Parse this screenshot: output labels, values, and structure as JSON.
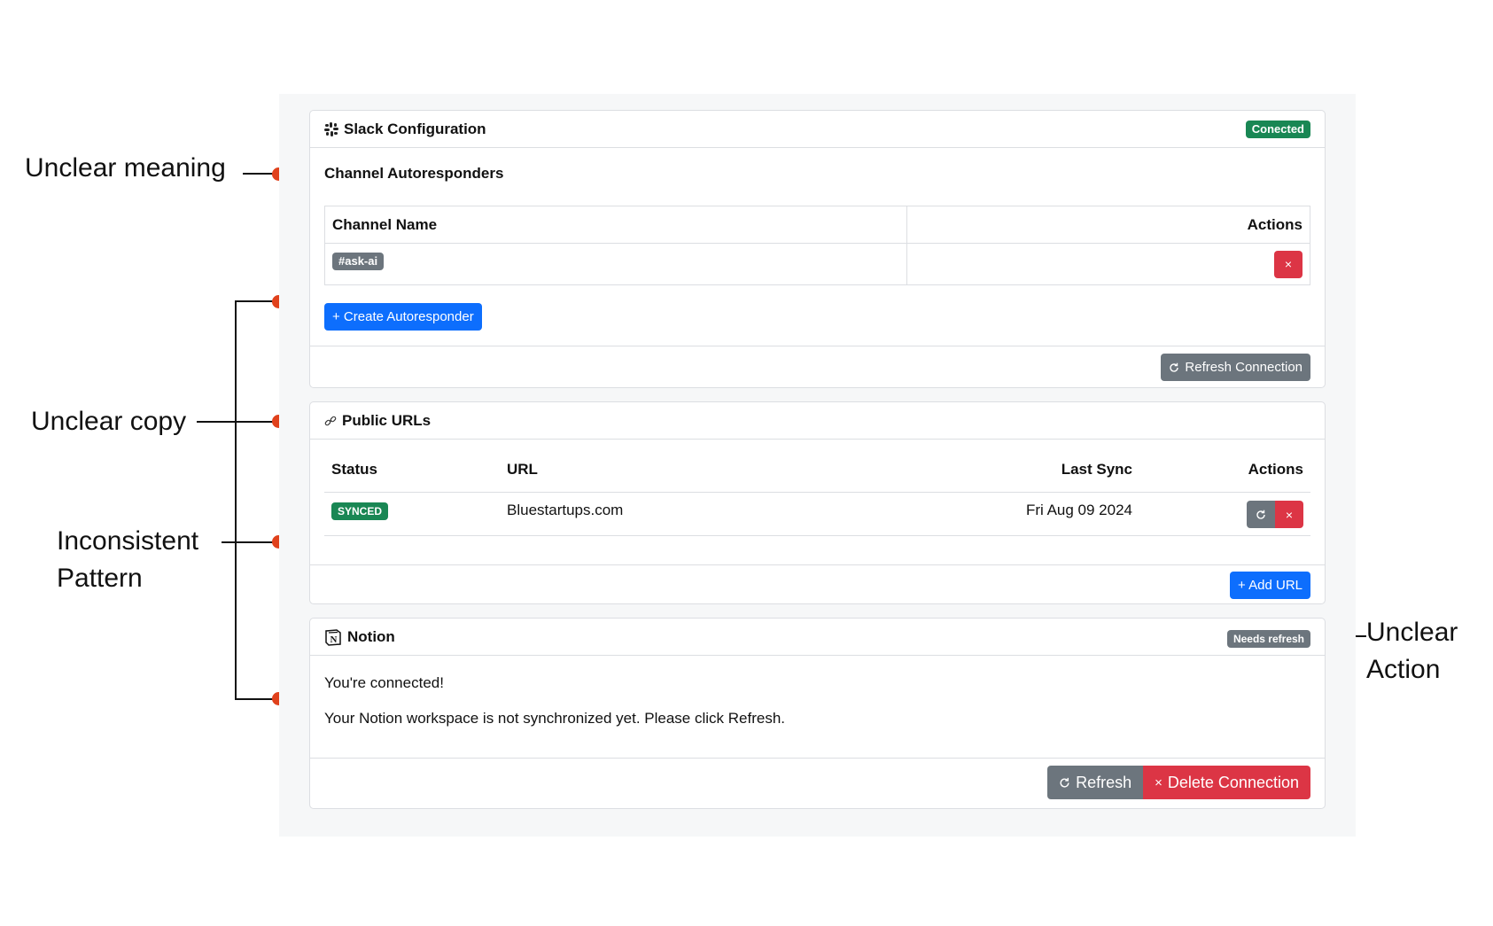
{
  "annotations": {
    "unclear_meaning": "Unclear meaning",
    "unclear_copy": "Unclear copy",
    "inconsistent_line1": "Inconsistent",
    "inconsistent_line2": "Pattern",
    "unclear_action_line1": "Unclear",
    "unclear_action_line2": "Action",
    "dot_color": "#e0411c"
  },
  "slack": {
    "title": "Slack Configuration",
    "icon": "slack-icon",
    "status_badge": "Conected",
    "section_title": "Channel Autoresponders",
    "columns": [
      "Channel Name",
      "Actions"
    ],
    "rows": [
      {
        "channel": "#ask-ai"
      }
    ],
    "delete_glyph": "×",
    "create_button": "+ Create Autoresponder",
    "refresh_button": "Refresh Connection"
  },
  "public_urls": {
    "title": "Public URLs",
    "icon": "link-icon",
    "columns": {
      "status": "Status",
      "url": "URL",
      "last_sync": "Last Sync",
      "actions": "Actions"
    },
    "rows": [
      {
        "status": "SYNCED",
        "url": "Bluestartups.com",
        "last_sync": "Fri Aug 09 2024"
      }
    ],
    "delete_glyph": "×",
    "add_button": "+ Add URL"
  },
  "notion": {
    "title": "Notion",
    "icon": "notion-icon",
    "status_badge": "Needs refresh",
    "line1": "You're connected!",
    "line2": "Your Notion workspace is not synchronized yet. Please click Refresh.",
    "refresh_button": "Refresh",
    "delete_button": "Delete Connection",
    "delete_glyph": "×"
  },
  "colors": {
    "primary": "#0d6efd",
    "secondary": "#6c757d",
    "danger": "#dc3545",
    "success": "#198754"
  }
}
